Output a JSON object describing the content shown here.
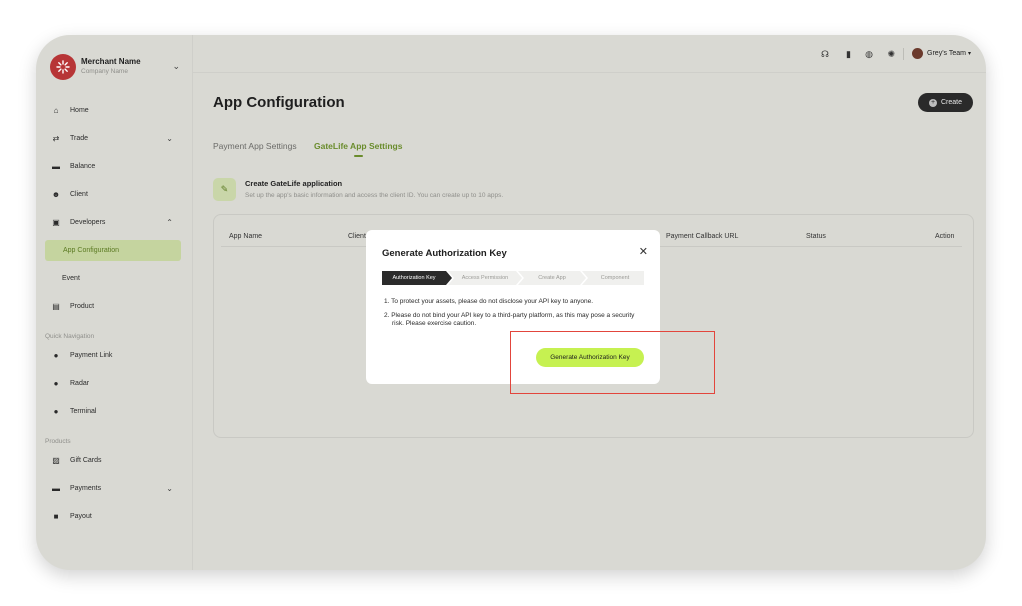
{
  "merchant": {
    "name": "Merchant Name",
    "company": "Company Name"
  },
  "sidebar": {
    "items": [
      {
        "label": "Home",
        "icon": "home-icon"
      },
      {
        "label": "Trade",
        "icon": "trade-icon"
      },
      {
        "label": "Balance",
        "icon": "balance-icon"
      },
      {
        "label": "Client",
        "icon": "client-icon"
      },
      {
        "label": "Developers",
        "icon": "developers-icon"
      },
      {
        "label": "App Configuration"
      },
      {
        "label": "Event"
      },
      {
        "label": "Product",
        "icon": "product-icon"
      }
    ],
    "quick_nav_label": "Quick Navigation",
    "quick_nav": [
      {
        "label": "Payment Link",
        "icon": "link-icon"
      },
      {
        "label": "Radar",
        "icon": "radar-icon"
      },
      {
        "label": "Terminal",
        "icon": "terminal-icon"
      }
    ],
    "products_label": "Products",
    "products": [
      {
        "label": "Gift Cards",
        "icon": "gift-card-icon"
      },
      {
        "label": "Payments",
        "icon": "payments-icon"
      },
      {
        "label": "Payout",
        "icon": "payout-icon"
      }
    ]
  },
  "topbar": {
    "team": "Grey's Team"
  },
  "page": {
    "title": "App Configuration",
    "create_label": "Create",
    "tabs": [
      "Payment App Settings",
      "GateLife App Settings"
    ],
    "create_app_title": "Create GateLife application",
    "create_app_desc": "Set up the app's basic information and access the client ID. You can create up to 10 apps."
  },
  "table": {
    "headers": [
      "App Name",
      "Client",
      "Payment Callback URL",
      "Status",
      "Action"
    ]
  },
  "modal": {
    "title": "Generate Authorization Key",
    "steps": [
      "Authorization Key",
      "Access Permission",
      "Create App",
      "Component"
    ],
    "active_step": 0,
    "notes": [
      "1. To protect your assets, please do not disclose your API key to anyone.",
      "2. Please do not bind your API key to a third-party platform, as this may pose a security risk. Please exercise caution."
    ],
    "button_label": "Generate Authorization Key"
  },
  "colors": {
    "accent": "#c6f151",
    "highlight_box": "#e2453c",
    "active_nav": "#c5d49f"
  }
}
